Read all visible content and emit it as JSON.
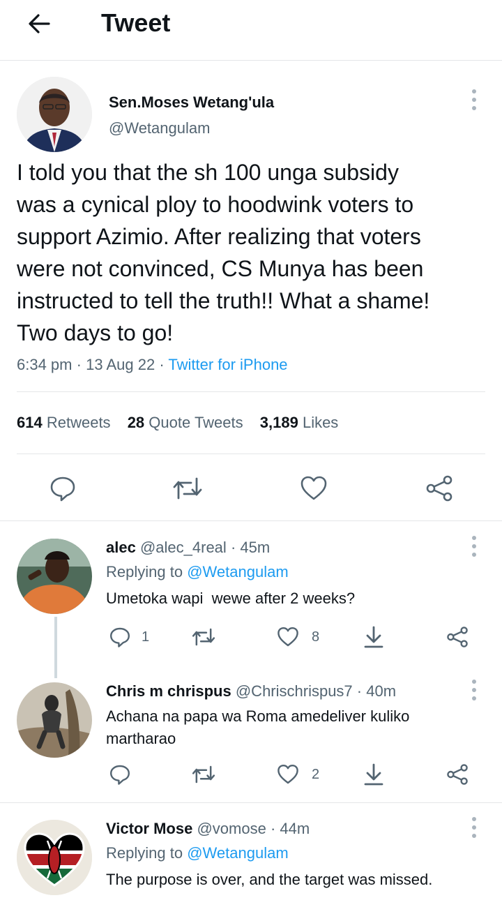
{
  "header": {
    "title": "Tweet"
  },
  "tweet": {
    "author_name": "Sen.Moses Wetang'ula",
    "author_handle": "@Wetangulam",
    "text_lines": [
      "I told you that the sh 100 unga subsidy",
      "was a cynical ploy to hoodwink voters to",
      "support Azimio. After realizing that voters",
      "were not convinced, CS Munya has been",
      "instructed to tell the truth!! What a shame!",
      "Two days to go!"
    ],
    "time": "6:34 pm",
    "date": "13 Aug 22",
    "separator": "·",
    "source": "Twitter for iPhone",
    "stats": {
      "retweets_count": "614",
      "retweets_label": "Retweets",
      "quotes_count": "28",
      "quotes_label": "Quote Tweets",
      "likes_count": "3,189",
      "likes_label": "Likes"
    }
  },
  "replies": [
    {
      "name": "alec",
      "handle": "@alec_4real",
      "separator": "·",
      "age": "45m",
      "replying_prefix": "Replying to",
      "replying_to": "@Wetangulam",
      "text_lines": [
        "Umetoka wapi  wewe after 2 weeks?"
      ],
      "reply_count": "1",
      "like_count": "8"
    },
    {
      "name": "Chris m chrispus",
      "handle": "@Chrischrispus7",
      "separator": "·",
      "age": "40m",
      "text_lines": [
        "Achana na papa wa Roma amedeliver kuliko",
        "martharao"
      ],
      "reply_count": "",
      "like_count": "2"
    },
    {
      "name": "Victor Mose",
      "handle": "@vomose",
      "separator": "·",
      "age": "44m",
      "replying_prefix": "Replying to",
      "replying_to": "@Wetangulam",
      "text_lines": [
        "The purpose is over, and the target was missed."
      ]
    }
  ],
  "icons": {
    "back": "back-arrow-icon",
    "more": "more-vertical-icon",
    "reply": "reply-icon",
    "retweet": "retweet-icon",
    "like": "heart-icon",
    "share": "share-icon",
    "download": "download-icon"
  },
  "colors": {
    "accent": "#1d9bf0",
    "muted": "#536471",
    "text": "#0f1419",
    "divider": "#e4e6e8"
  }
}
